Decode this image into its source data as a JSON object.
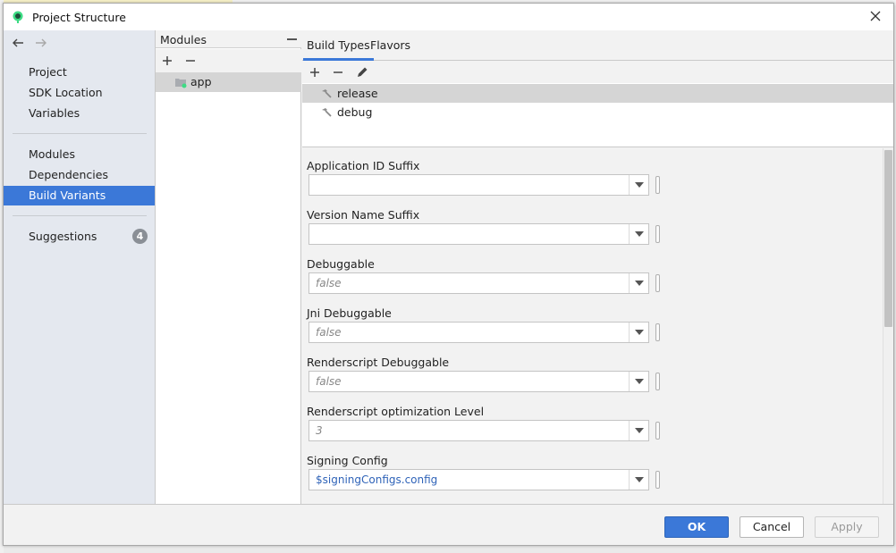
{
  "window": {
    "title": "Project Structure"
  },
  "sidebar": {
    "items": [
      {
        "label": "Project"
      },
      {
        "label": "SDK Location"
      },
      {
        "label": "Variables"
      },
      {
        "label": "Modules"
      },
      {
        "label": "Dependencies"
      },
      {
        "label": "Build Variants",
        "selected": true
      },
      {
        "label": "Suggestions",
        "badge": "4"
      }
    ]
  },
  "modules": {
    "title": "Modules",
    "items": [
      {
        "label": "app",
        "selected": true
      }
    ]
  },
  "tabs": [
    {
      "label": "Build Types",
      "active": true
    },
    {
      "label": "Flavors"
    }
  ],
  "build_types": [
    {
      "label": "release",
      "selected": true
    },
    {
      "label": "debug"
    }
  ],
  "form": {
    "fields": [
      {
        "label": "Application ID Suffix",
        "value": ""
      },
      {
        "label": "Version Name Suffix",
        "value": ""
      },
      {
        "label": "Debuggable",
        "value": "false"
      },
      {
        "label": "Jni Debuggable",
        "value": "false"
      },
      {
        "label": "Renderscript Debuggable",
        "value": "false"
      },
      {
        "label": "Renderscript optimization Level",
        "value": "3"
      },
      {
        "label": "Signing Config",
        "value": "$signingConfigs.config"
      }
    ]
  },
  "buttons": {
    "ok": "OK",
    "cancel": "Cancel",
    "apply": "Apply"
  },
  "colors": {
    "accent": "#3b78d8",
    "sidebar_bg": "#e4e8ef",
    "link": "#2f63b8"
  }
}
